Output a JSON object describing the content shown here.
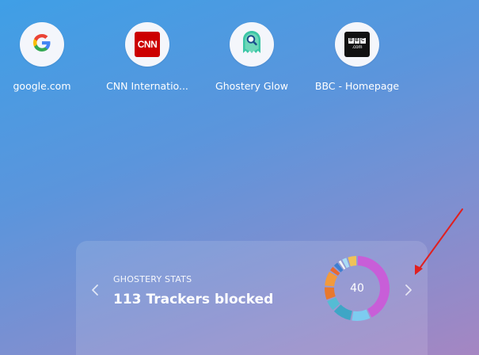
{
  "shortcuts": [
    {
      "label": "google.com",
      "icon": "google-icon",
      "glyph": "G"
    },
    {
      "label": "CNN Internatio...",
      "icon": "cnn-icon",
      "glyph": "CNN"
    },
    {
      "label": "Ghostery Glow",
      "icon": "ghostery-glow-icon"
    },
    {
      "label": "BBC - Homepage",
      "icon": "bbc-icon",
      "glyph_letters": [
        "B",
        "B",
        "C"
      ],
      "glyph_suffix": ".com"
    }
  ],
  "stats": {
    "eyebrow": "GHOSTERY STATS",
    "count": "113",
    "label": "Trackers blocked",
    "center_value": "40",
    "segments": [
      {
        "color": "#c85ed8",
        "fraction": 0.43
      },
      {
        "color": "#7dccf0",
        "fraction": 0.1
      },
      {
        "color": "#3ea6c6",
        "fraction": 0.1
      },
      {
        "color": "#55bcd4",
        "fraction": 0.06
      },
      {
        "color": "#e8782e",
        "fraction": 0.07
      },
      {
        "color": "#f29a3c",
        "fraction": 0.08
      },
      {
        "color": "#e9692f",
        "fraction": 0.03
      },
      {
        "color": "#3e7fd0",
        "fraction": 0.03
      },
      {
        "color": "#f4f4f4",
        "fraction": 0.02
      },
      {
        "color": "#a9dcf6",
        "fraction": 0.03
      },
      {
        "color": "#efc258",
        "fraction": 0.05
      }
    ]
  },
  "colors": {
    "background_top": "#3f9fe6",
    "background_bottom": "#a586c2",
    "annotation_arrow": "#e02020"
  },
  "icons": {
    "prev": "chevron-left-icon",
    "next": "chevron-right-icon"
  }
}
